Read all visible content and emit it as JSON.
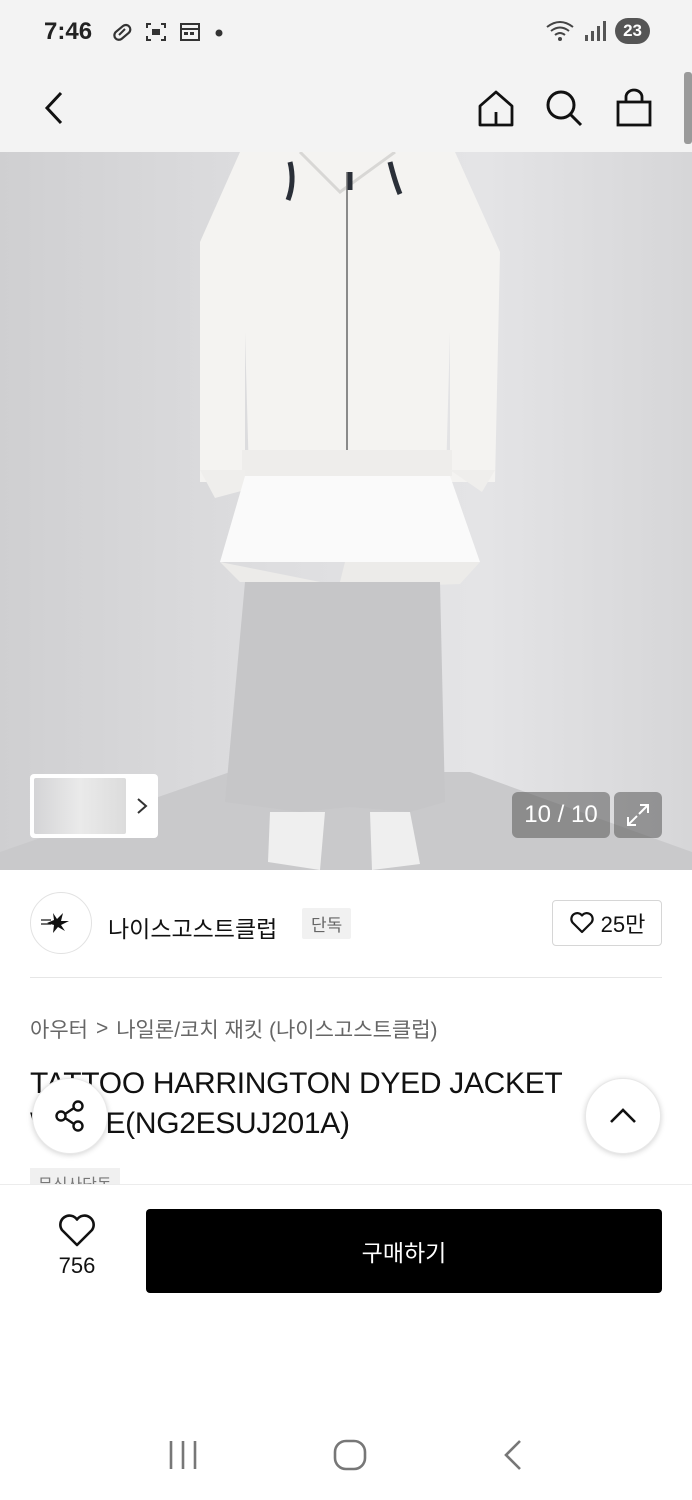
{
  "status_bar": {
    "time": "7:46",
    "battery": "23",
    "left_icons": [
      "pill-icon",
      "screenshot-icon",
      "calendar-icon",
      "dot-icon"
    ],
    "right_icons": [
      "wifi-icon",
      "signal-icon"
    ]
  },
  "nav": {
    "back_icon": "chevron-left-icon",
    "home_icon": "home-icon",
    "search_icon": "search-icon",
    "bag_icon": "shopping-bag-icon"
  },
  "gallery": {
    "counter": "10 / 10",
    "expand_icon": "expand-icon",
    "thumb_arrow_icon": "chevron-right-icon"
  },
  "brand": {
    "name": "나이스고스트클럽",
    "badge": "단독",
    "likes": "25만"
  },
  "breadcrumb": {
    "category": "아우터",
    "separator": ">",
    "subcategory": "나일론/코치 재킷 (나이스고스트클럽)"
  },
  "product": {
    "title": "TATTOO HARRINGTON DYED JACKET WHITE(NG2ESUJ201A)",
    "tag": "무신사단독"
  },
  "bottom": {
    "wish_count": "756",
    "buy_label": "구매하기"
  },
  "colors": {
    "buy_button": "#000000",
    "nav_bg": "#f3f3f3",
    "text": "#111111"
  }
}
